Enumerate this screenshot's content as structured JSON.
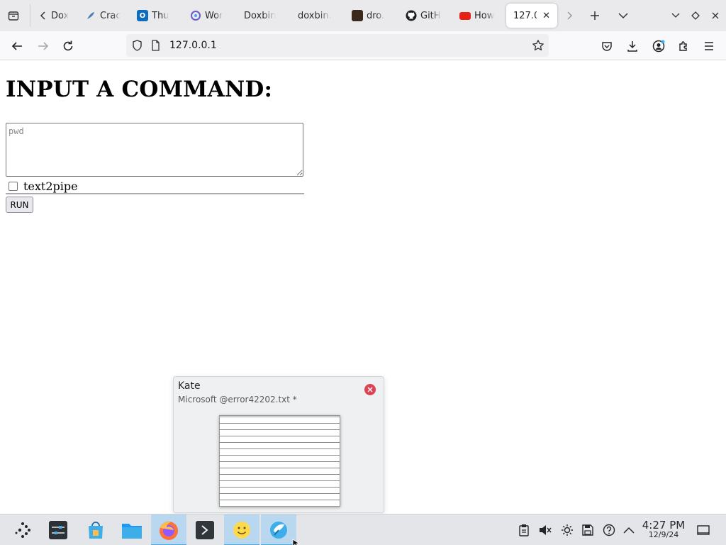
{
  "browser": {
    "tabs": [
      {
        "title": "Dox",
        "favicon": "tab-scroll-back-icon"
      },
      {
        "title": "Crac",
        "favicon": "feather-icon"
      },
      {
        "title": "Thu",
        "favicon": "outlook-icon"
      },
      {
        "title": "Wor",
        "favicon": "spark-icon"
      },
      {
        "title": "Doxbin",
        "favicon": ""
      },
      {
        "title": "doxbin.",
        "favicon": ""
      },
      {
        "title": "dro.",
        "favicon": "site-icon"
      },
      {
        "title": "GitH",
        "favicon": "github-icon"
      },
      {
        "title": "How",
        "favicon": "youtube-icon"
      }
    ],
    "active_tab": {
      "title": "127.0",
      "close": "✕"
    },
    "url": "127.0.0.1"
  },
  "page": {
    "heading": "INPUT A COMMAND:",
    "command_placeholder": "pwd",
    "command_value": "",
    "checkbox_label": "text2pipe",
    "checkbox_checked": false,
    "run_label": "RUN"
  },
  "popup": {
    "app_name": "Kate",
    "window_title": "Microsoft @error42202.txt *"
  },
  "taskbar": {
    "time": "4:27 PM",
    "date": "12/9/24"
  },
  "colors": {
    "accent": "#3daee9",
    "close_red": "#da4453",
    "firefox_orange": "#ff7139"
  }
}
